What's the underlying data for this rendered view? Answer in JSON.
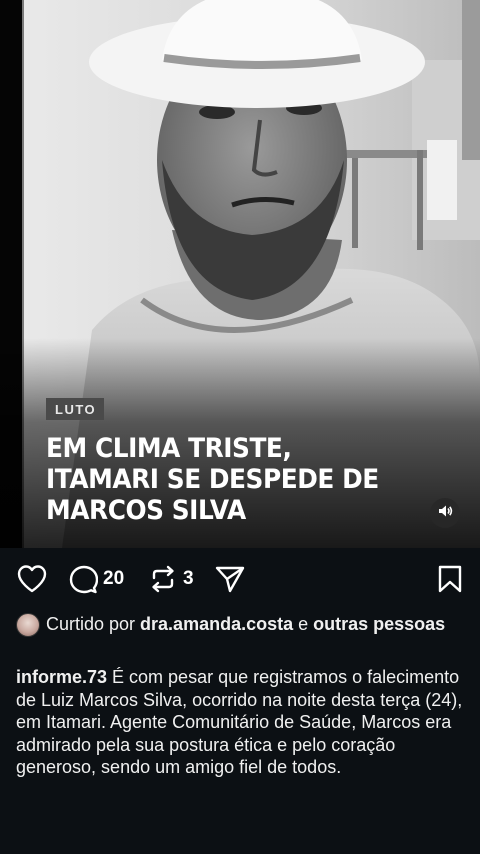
{
  "post": {
    "tag": "LUTO",
    "headline": "EM CLIMA TRISTE, ITAMARI SE DESPEDE DE MARCOS SILVA",
    "media_type": "video",
    "audio_icon": "speaker-icon"
  },
  "actions": {
    "like_icon": "heart-icon",
    "comment_icon": "comment-bubble-icon",
    "comments_count": "20",
    "repost_icon": "repost-icon",
    "reposts_count": "3",
    "share_icon": "paper-plane-icon",
    "save_icon": "bookmark-icon"
  },
  "likes": {
    "prefix": "Curtido por ",
    "user": "dra.amanda.costa",
    "middle": " e ",
    "others": "outras pessoas"
  },
  "caption": {
    "username": "informe.73",
    "text": " É com pesar que registramos o falecimento de Luiz Marcos Silva, ocorrido na noite desta terça (24), em Itamari. Agente Comunitário de Saúde, Marcos era admirado pela sua postura ética e pelo coração generoso, sendo um amigo fiel de todos."
  },
  "colors": {
    "background": "#0c1014",
    "text": "#f5f5f5",
    "tag_bg": "#4a4a4a"
  }
}
